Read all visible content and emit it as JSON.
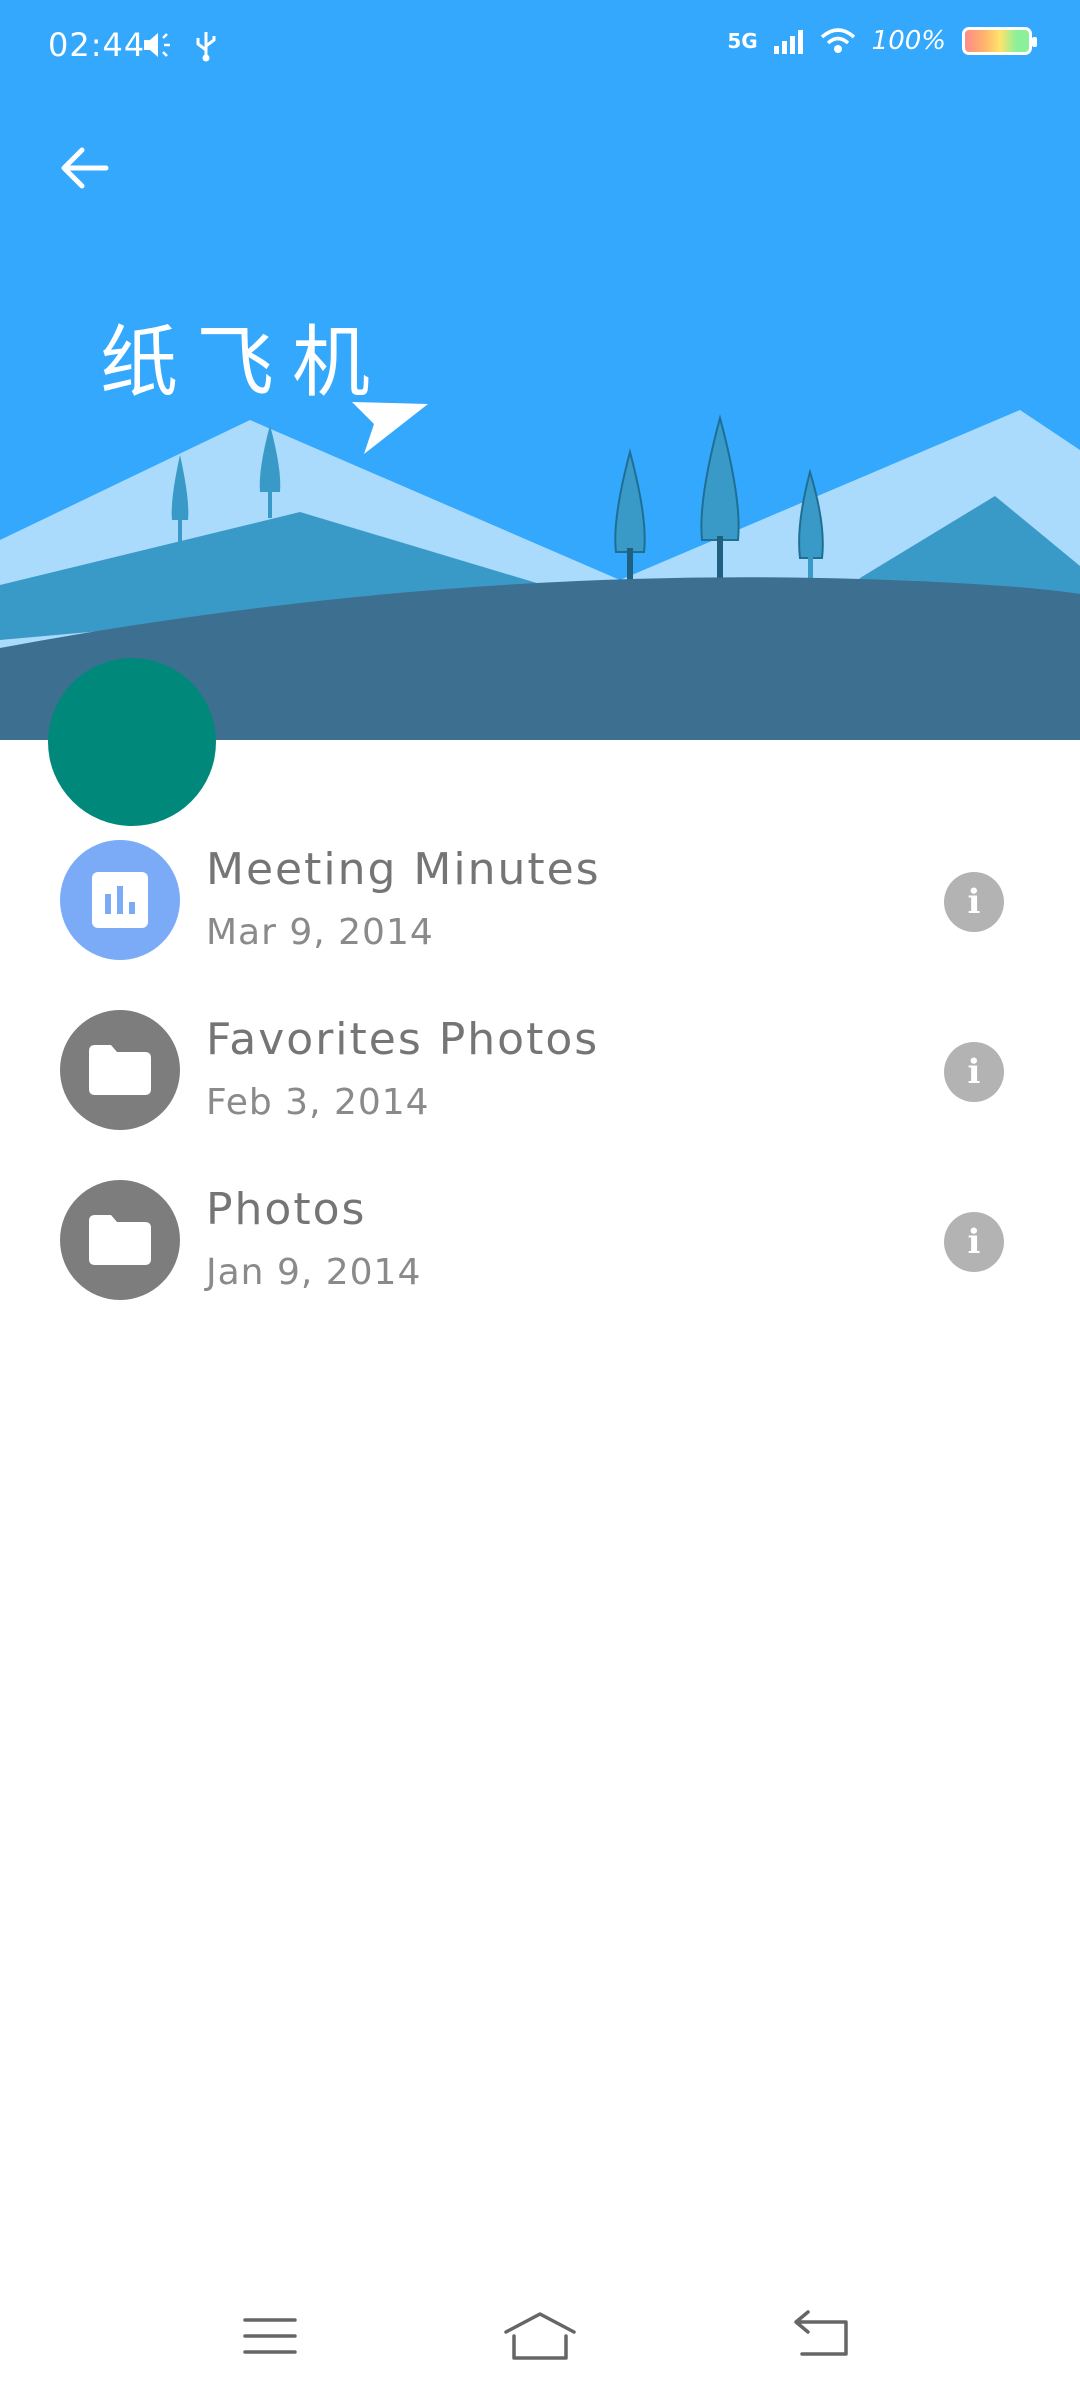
{
  "status_bar": {
    "time": "02:44",
    "network": "5G",
    "battery": "100%",
    "icons": [
      "mute-icon",
      "usb-icon",
      "signal-icon",
      "wifi-icon",
      "battery-icon"
    ]
  },
  "header": {
    "title": "纸飞机",
    "background_color": "#34a8fd",
    "back_icon": "arrow-left-icon"
  },
  "files": [
    {
      "title": "Meeting Minutes",
      "date": "Mar 9, 2014",
      "icon": "chart-icon",
      "icon_color": "#7baaf7"
    },
    {
      "title": "Favorites Photos",
      "date": "Feb 3, 2014",
      "icon": "folder-icon",
      "icon_color": "#7d7d7d"
    },
    {
      "title": "Photos",
      "date": "Jan 9, 2014",
      "icon": "folder-icon",
      "icon_color": "#7d7d7d"
    }
  ],
  "avatar_color": "#00897b",
  "nav_bar": [
    "menu-icon",
    "home-icon",
    "back-icon"
  ]
}
